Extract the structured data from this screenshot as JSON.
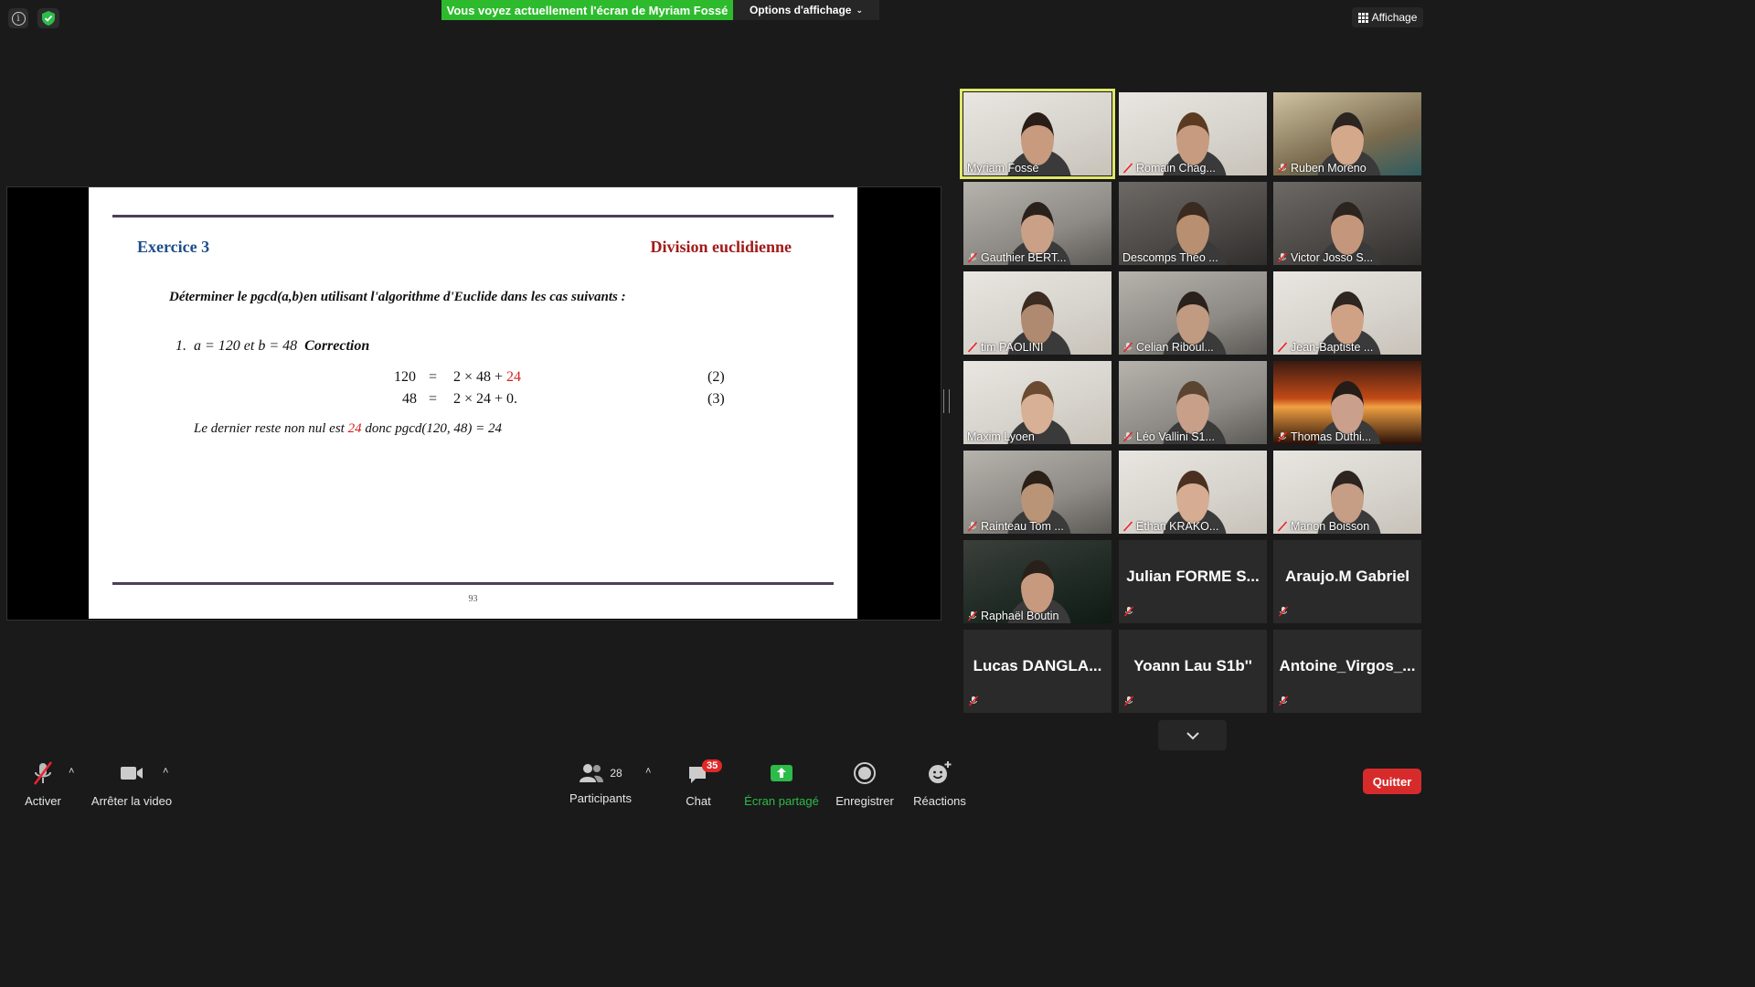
{
  "top": {
    "share_banner": "Vous voyez actuellement l'écran de Myriam Fossé",
    "options": "Options d'affichage",
    "view": "Affichage"
  },
  "slide": {
    "title": "Exercice 3",
    "topic": "Division euclidienne",
    "instruction": "Déterminer le pgcd(a,b)en utilisant l'algorithme d'Euclide dans les cas suivants :",
    "item": {
      "number": "1.",
      "text": "a = 120  et b = 48",
      "correction": "Correction"
    },
    "equations": [
      {
        "lhs": "120",
        "rhs": "2 × 48 + ",
        "rest": "24",
        "tag": "(2)"
      },
      {
        "lhs": "48",
        "rhs": "2 × 24 + 0.",
        "rest": "",
        "tag": "(3)"
      }
    ],
    "conclusion_a": "Le dernier reste non nul est ",
    "conclusion_rest": "24",
    "conclusion_b": " donc pgcd(120, 48) = 24",
    "page_number": "93"
  },
  "participants_tiles": [
    {
      "name": "Myriam Fossé",
      "muted": false,
      "active": true
    },
    {
      "name": "Romain Chag...",
      "muted": true
    },
    {
      "name": "Ruben Moreno",
      "muted": true
    },
    {
      "name": "Gauthier BERT...",
      "muted": true
    },
    {
      "name": "Descomps Théo ...",
      "muted": false
    },
    {
      "name": "Victor Josso S...",
      "muted": true
    },
    {
      "name": "tim PAOLINI",
      "muted": true
    },
    {
      "name": "Celian Riboul...",
      "muted": true
    },
    {
      "name": "Jean-Baptiste ...",
      "muted": true
    },
    {
      "name": "Maxim Lyoen",
      "muted": false
    },
    {
      "name": "Léo Vallini S1...",
      "muted": true
    },
    {
      "name": "Thomas Duthi...",
      "muted": true
    },
    {
      "name": "Rainteau Tom ...",
      "muted": true
    },
    {
      "name": "Ethan KRAKO...",
      "muted": true
    },
    {
      "name": "Manon Boisson",
      "muted": true
    },
    {
      "name": "Raphaël Boutin",
      "muted": true
    },
    {
      "name": "Julian  FORME  S...",
      "muted": true
    },
    {
      "name": "Araujo.M Gabriel",
      "muted": true
    },
    {
      "name": "Lucas  DANGLA...",
      "muted": true
    },
    {
      "name": "Yoann Lau S1b''",
      "muted": true
    },
    {
      "name": "Antoine_Virgos_...",
      "muted": true
    }
  ],
  "toolbar": {
    "mic": "Activer",
    "video": "Arrêter la video",
    "participants_count": "28",
    "participants": "Participants",
    "chat": "Chat",
    "chat_badge": "35",
    "share": "Écran partagé",
    "record": "Enregistrer",
    "reactions": "Réactions",
    "quit": "Quitter"
  },
  "colors": {
    "share_green": "#2dbb2d",
    "quit_red": "#d72b2b",
    "active_speaker": "#dfe86a"
  }
}
